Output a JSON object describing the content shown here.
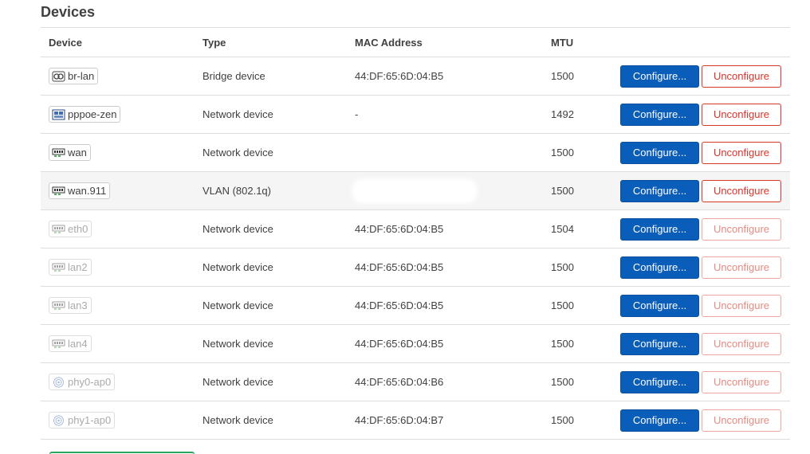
{
  "section": {
    "title": "Devices"
  },
  "table": {
    "headers": {
      "device": "Device",
      "type": "Type",
      "mac": "MAC Address",
      "mtu": "MTU"
    },
    "rows": [
      {
        "device": "br-lan",
        "icon": "bridge-icon",
        "type": "Bridge device",
        "mac": "44:DF:65:6D:04:B5",
        "mtu": "1500",
        "dim": false,
        "highlight": false,
        "mac_redacted": false
      },
      {
        "device": "pppoe-zen",
        "icon": "tunnel-icon",
        "type": "Network device",
        "mac": "-",
        "mtu": "1492",
        "dim": false,
        "highlight": false,
        "mac_redacted": false
      },
      {
        "device": "wan",
        "icon": "ethernet-icon",
        "type": "Network device",
        "mac": "",
        "mtu": "1500",
        "dim": false,
        "highlight": false,
        "mac_redacted": true
      },
      {
        "device": "wan.911",
        "icon": "ethernet-icon",
        "type": "VLAN (802.1q)",
        "mac": "",
        "mtu": "1500",
        "dim": false,
        "highlight": true,
        "mac_redacted": true
      },
      {
        "device": "eth0",
        "icon": "ethernet-icon",
        "type": "Network device",
        "mac": "44:DF:65:6D:04:B5",
        "mtu": "1504",
        "dim": true,
        "highlight": false,
        "mac_redacted": false
      },
      {
        "device": "lan2",
        "icon": "ethernet-icon",
        "type": "Network device",
        "mac": "44:DF:65:6D:04:B5",
        "mtu": "1500",
        "dim": true,
        "highlight": false,
        "mac_redacted": false
      },
      {
        "device": "lan3",
        "icon": "ethernet-icon",
        "type": "Network device",
        "mac": "44:DF:65:6D:04:B5",
        "mtu": "1500",
        "dim": true,
        "highlight": false,
        "mac_redacted": false
      },
      {
        "device": "lan4",
        "icon": "ethernet-icon",
        "type": "Network device",
        "mac": "44:DF:65:6D:04:B5",
        "mtu": "1500",
        "dim": true,
        "highlight": false,
        "mac_redacted": false
      },
      {
        "device": "phy0-ap0",
        "icon": "wifi-icon",
        "type": "Network device",
        "mac": "44:DF:65:6D:04:B6",
        "mtu": "1500",
        "dim": true,
        "highlight": false,
        "mac_redacted": false
      },
      {
        "device": "phy1-ap0",
        "icon": "wifi-icon",
        "type": "Network device",
        "mac": "44:DF:65:6D:04:B7",
        "mtu": "1500",
        "dim": true,
        "highlight": false,
        "mac_redacted": false
      }
    ]
  },
  "actions": {
    "configure_label": "Configure...",
    "unconfigure_label": "Unconfigure"
  },
  "colors": {
    "primary": "#0b5dba",
    "danger": "#d9342b",
    "add_button_border": "#2aa65c"
  }
}
